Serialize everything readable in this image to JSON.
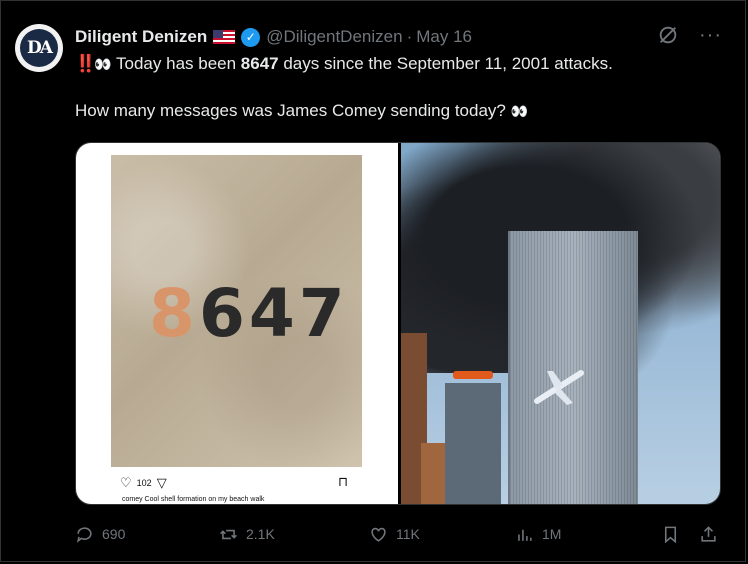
{
  "post": {
    "author_name": "Diligent Denizen",
    "author_flag": "🇺🇸",
    "handle": "@DiligentDenizen",
    "separator": "·",
    "date": "May 16",
    "line1_prefix": "‼️",
    "line1_eyes": "👀",
    "line1_text_before": " Today has been ",
    "line1_number": "8647",
    "line1_text_after": " days since the September 11, 2001 attacks.",
    "line2_text": "How many messages was James Comey sending today? ",
    "line2_eyes": "👀"
  },
  "media": {
    "left": {
      "sand_digits": "8647",
      "ig_like_count": "102",
      "ig_caption": "comey Cool shell formation on my beach walk"
    }
  },
  "actions": {
    "replies": "690",
    "reposts": "2.1K",
    "likes": "11K",
    "views": "1M"
  },
  "colors": {
    "background": "#000000",
    "text": "#e7e9ea",
    "muted": "#71767b",
    "verified": "#1d9bf0",
    "border": "#2f3336"
  },
  "icons": [
    "grok-icon",
    "more-icon",
    "verified-icon",
    "reply-icon",
    "repost-icon",
    "like-icon",
    "views-icon",
    "bookmark-icon",
    "share-icon"
  ]
}
